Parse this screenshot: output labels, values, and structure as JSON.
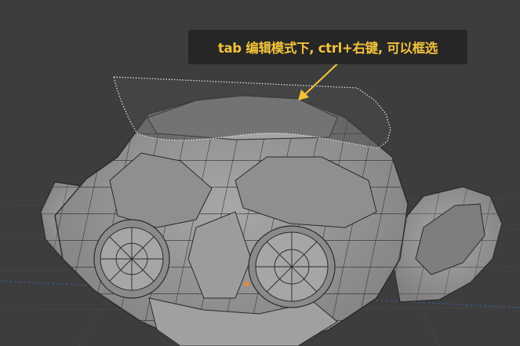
{
  "viewport": {
    "background_color": "#3d3d3d",
    "mesh_name": "Suzanne",
    "mode": "edit",
    "selection_method": "lasso"
  },
  "annotation": {
    "text": "tab 编辑模式下, ctrl+右键, 可以框选",
    "text_color": "#f2c23a",
    "background_color": "#262626",
    "arrow_color": "#f2c23a"
  },
  "colors": {
    "mesh_face": "#9a9a9a",
    "mesh_wire": "#2a2a2a",
    "selection_fill": "#5a5a5a",
    "selection_outline": "#e8e8e8",
    "origin_dot": "#f08a24",
    "axis_x_line": "#3c5a8c"
  }
}
